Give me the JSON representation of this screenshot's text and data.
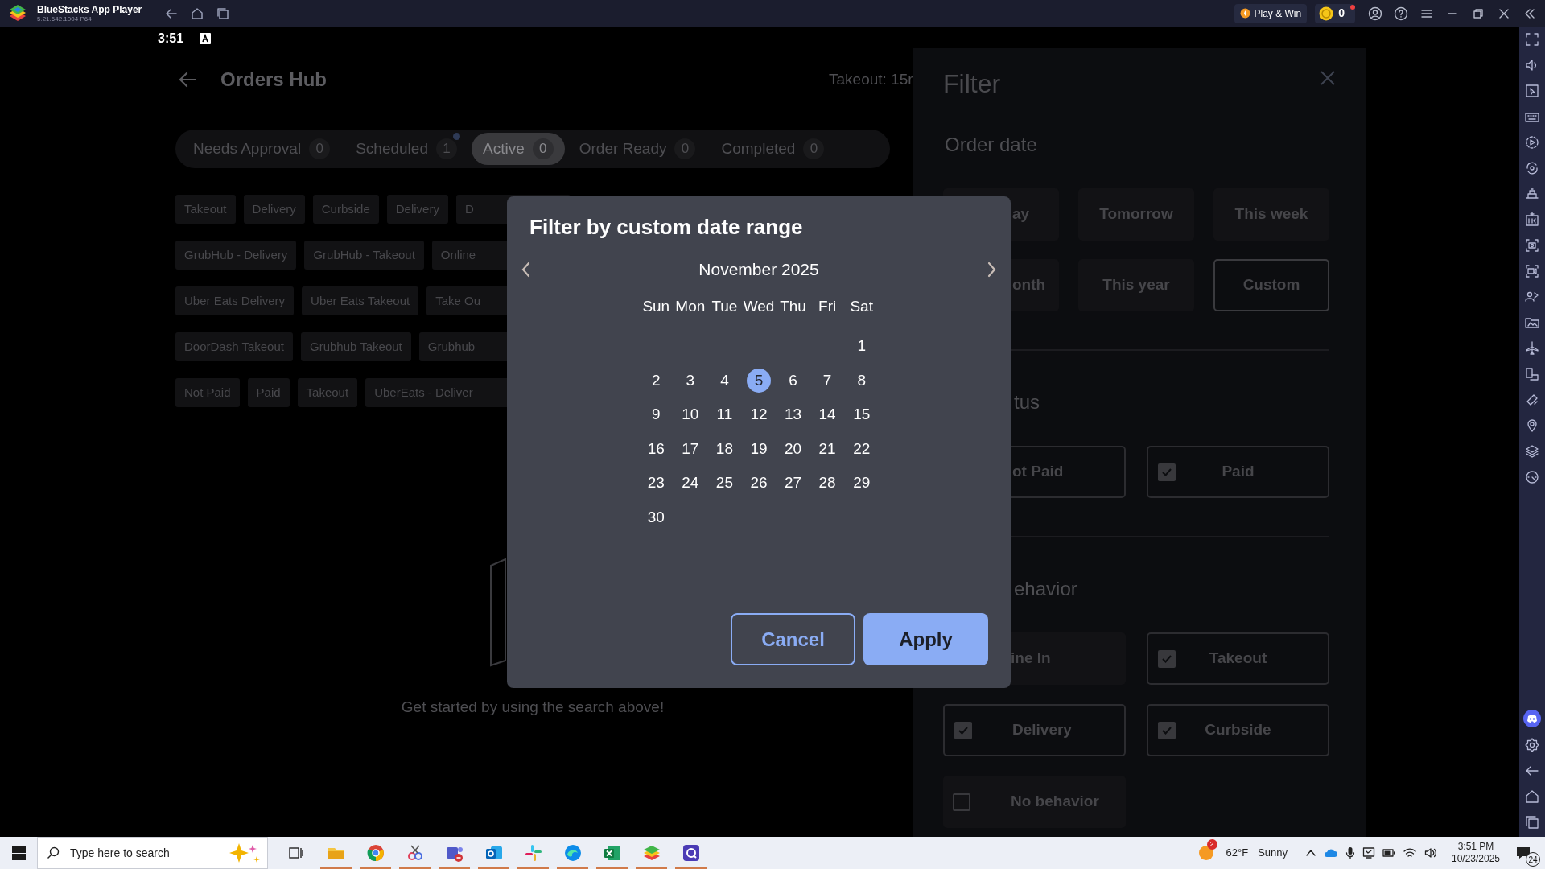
{
  "app_bar": {
    "title": "BlueStacks App Player",
    "version": "5.21.642.1004 P64",
    "play_and_win": "Play & Win",
    "coins": "0"
  },
  "status_bar": {
    "time": "3:51"
  },
  "header": {
    "title": "Orders Hub",
    "prep_time": "Takeout: 15r"
  },
  "tabs": [
    {
      "label": "Needs Approval",
      "count": "0",
      "selected": false,
      "dot": false
    },
    {
      "label": "Scheduled",
      "count": "1",
      "selected": false,
      "dot": true
    },
    {
      "label": "Active",
      "count": "0",
      "selected": true,
      "dot": false
    },
    {
      "label": "Order Ready",
      "count": "0",
      "selected": false,
      "dot": false
    },
    {
      "label": "Completed",
      "count": "0",
      "selected": false,
      "dot": false
    }
  ],
  "chip_rows": [
    {
      "chips": [
        "Takeout",
        "Delivery",
        "Curbside",
        "Delivery",
        "D"
      ]
    },
    {
      "chips": [
        "GrubHub - Delivery",
        "GrubHub - Takeout",
        "Online"
      ]
    },
    {
      "chips": [
        "Uber Eats Delivery",
        "Uber Eats Takeout",
        "Take Ou"
      ]
    },
    {
      "chips": [
        "DoorDash Takeout",
        "Grubhub Takeout",
        "Grubhub"
      ]
    },
    {
      "chips": [
        "Not Paid",
        "Paid",
        "Takeout",
        "UberEats - Deliver"
      ]
    }
  ],
  "empty_state": {
    "message": "Get started by using the search above!"
  },
  "filter_panel": {
    "title": "Filter",
    "sections": [
      {
        "heading": "Order date",
        "kind": "presets",
        "options": [
          {
            "label": "ay",
            "selected": false
          },
          {
            "label": "Tomorrow",
            "selected": false
          },
          {
            "label": "This week",
            "selected": false
          },
          {
            "label": "onth",
            "selected": false
          },
          {
            "label": "This year",
            "selected": false
          },
          {
            "label": "Custom",
            "selected": true
          }
        ]
      },
      {
        "heading": "tus",
        "kind": "checks",
        "options": [
          {
            "label": "ot Paid",
            "checked": true
          },
          {
            "label": "Paid",
            "checked": true
          }
        ]
      },
      {
        "heading": "ehavior",
        "kind": "checks",
        "options": [
          {
            "label": "ine In",
            "checked": false
          },
          {
            "label": "Takeout",
            "checked": true
          },
          {
            "label": "Delivery",
            "checked": true
          },
          {
            "label": "Curbside",
            "checked": true
          },
          {
            "label": "No behavior",
            "checked": false
          }
        ]
      }
    ]
  },
  "dialog": {
    "title": "Filter by custom date range",
    "month": "November 2025",
    "weekdays": [
      "Sun",
      "Mon",
      "Tue",
      "Wed",
      "Thu",
      "Fri",
      "Sat"
    ],
    "weeks": [
      [
        {
          "label": "1",
          "selected": false
        }
      ],
      [
        {
          "label": "2",
          "selected": false
        },
        {
          "label": "3",
          "selected": false
        },
        {
          "label": "4",
          "selected": false
        },
        {
          "label": "5",
          "selected": true
        },
        {
          "label": "6",
          "selected": false
        },
        {
          "label": "7",
          "selected": false
        },
        {
          "label": "8",
          "selected": false
        }
      ],
      [
        {
          "label": "9",
          "selected": false
        },
        {
          "label": "10",
          "selected": false
        },
        {
          "label": "11",
          "selected": false
        },
        {
          "label": "12",
          "selected": false
        },
        {
          "label": "13",
          "selected": false
        },
        {
          "label": "14",
          "selected": false
        },
        {
          "label": "15",
          "selected": false
        }
      ],
      [
        {
          "label": "16",
          "selected": false
        },
        {
          "label": "17",
          "selected": false
        },
        {
          "label": "18",
          "selected": false
        },
        {
          "label": "19",
          "selected": false
        },
        {
          "label": "20",
          "selected": false
        },
        {
          "label": "21",
          "selected": false
        },
        {
          "label": "22",
          "selected": false
        }
      ],
      [
        {
          "label": "23",
          "selected": false
        },
        {
          "label": "24",
          "selected": false
        },
        {
          "label": "25",
          "selected": false
        },
        {
          "label": "26",
          "selected": false
        },
        {
          "label": "27",
          "selected": false
        },
        {
          "label": "28",
          "selected": false
        },
        {
          "label": "29",
          "selected": false
        }
      ],
      [
        {
          "label": "30",
          "selected": false
        }
      ]
    ],
    "cancel": "Cancel",
    "apply": "Apply"
  },
  "taskbar": {
    "search_placeholder": "Type here to search",
    "weather_badge": "2",
    "temperature": "62°F",
    "condition": "Sunny",
    "time": "3:51 PM",
    "date": "10/23/2025",
    "notifications": "24"
  }
}
